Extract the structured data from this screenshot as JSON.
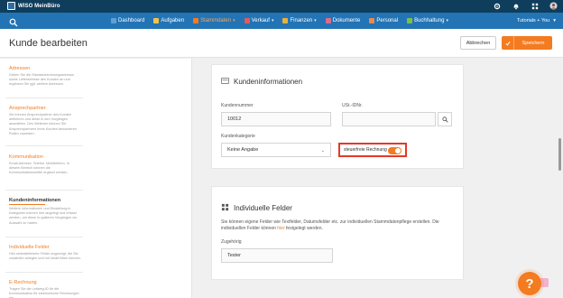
{
  "app": {
    "title": "WISO MeinBüro"
  },
  "colors": {
    "accent": "#f47b20",
    "nav": "#2274b5",
    "topbar": "#0f3e5c",
    "highlight": "#e03a2c"
  },
  "topbar_icons": [
    "gear-icon",
    "bell-icon",
    "grid-icon",
    "avatar"
  ],
  "nav": {
    "items": [
      {
        "label": "Dashboard",
        "color": "#5fa0d6"
      },
      {
        "label": "Aufgaben",
        "color": "#f0c44a"
      },
      {
        "label": "Stammdaten",
        "color": "#f47b20",
        "active": true,
        "caret": "▾"
      },
      {
        "label": "Verkauf",
        "color": "#e05c5c",
        "caret": "▾"
      },
      {
        "label": "Finanzen",
        "color": "#e8b040",
        "caret": "▾"
      },
      {
        "label": "Dokumente",
        "color": "#e06a8a"
      },
      {
        "label": "Personal",
        "color": "#e88a50"
      },
      {
        "label": "Buchhaltung",
        "color": "#7cc04a",
        "caret": "▾"
      }
    ],
    "right_label": "Tutorials + You",
    "right_caret": "▾"
  },
  "header": {
    "title": "Kunde bearbeiten",
    "cancel_label": "Abbrechen",
    "save_label": "Speichern"
  },
  "sidebar": {
    "sections": [
      {
        "heading": "Adressen",
        "desc": "Geben Sie die Standardrechnungsadresse, sowie Lieferadresse des Kunden an und ergänzen Sie ggf. weitere Adressen."
      },
      {
        "heading": "Ansprechpartner",
        "desc": "Sie können Ansprechpartner des Kunden definieren und diese in den Vorgängen auswählen. Des Weiteren können Sie Ansprechpartnern Ihres Kunden besonderen Rollen zuweisen."
      },
      {
        "heading": "Kommunikation",
        "desc": "Email-Adresse, Telefon, Mobiltelefon. In diesem Bereich können die Kommunikationsmittel ergänzt werden."
      },
      {
        "heading": "Kundeninformationen",
        "desc": "Weitere Informationen und Einstellung in Kategorien können hier angelegt und erfasst werden, um diese in späteren Vorgängen zur Auswahl zu haben."
      },
      {
        "heading": "Individuelle Felder",
        "desc": "Hier selbstdefinierte Felder angezeigt, die Sie zusätzlich anlegen und mit Inhalt füllen können."
      },
      {
        "heading": "E-Rechnung",
        "desc": "Tragen Sie die Leitweg-ID für die Kommunikation für elektronische Rechnungen ein."
      }
    ]
  },
  "kundeninfo": {
    "title": "Kundeninformationen",
    "kundennummer_label": "Kundennummer",
    "kundennummer_value": "10012",
    "ust_label": "USt.-IDNr.",
    "ust_value": "",
    "kategorie_label": "Kundenkategorie",
    "kategorie_value": "Keine Angabe",
    "steuerfrei_label": "steuerfreie Rechnung",
    "steuerfrei_on": true
  },
  "individuelle": {
    "title": "Individuelle Felder",
    "desc_part1": "Sie können eigene Felder wie Textfelder, Datumsfelder etc. zur individuellen Stammdatenpflege erstellen. Die individuellen Felder können ",
    "desc_link": "hier",
    "desc_part2": " festgelegt werden.",
    "field_label": "Zugehörig",
    "field_value": "Tester"
  },
  "help": {
    "label": "?"
  }
}
